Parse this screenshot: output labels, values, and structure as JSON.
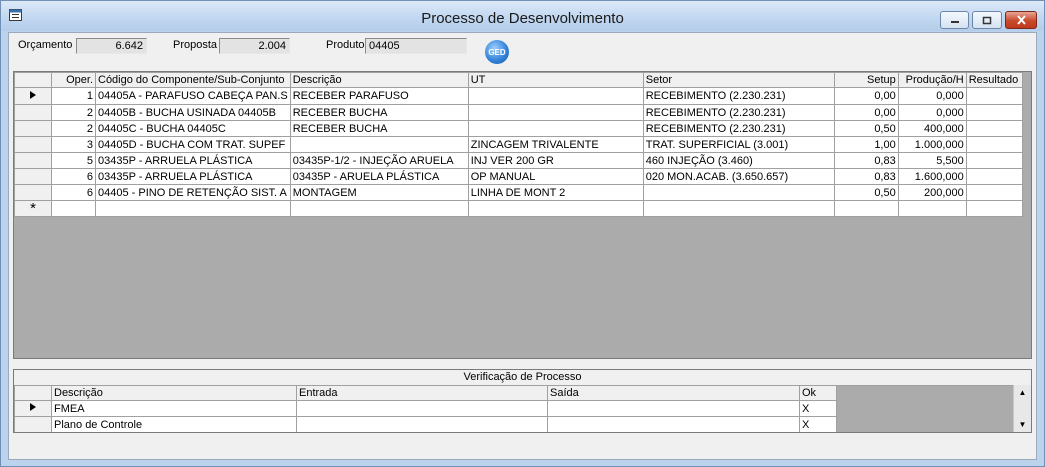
{
  "window": {
    "title": "Processo de Desenvolvimento"
  },
  "header": {
    "orcamento_label": "Orçamento",
    "orcamento_value": "6.642",
    "proposta_label": "Proposta",
    "proposta_value": "2.004",
    "produto_label": "Produto",
    "produto_value": "04405",
    "ged_label": "GED"
  },
  "grid": {
    "columns": [
      "Oper.",
      "Código do Componente/Sub-Conjunto",
      "Descrição",
      "UT",
      "Setor",
      "Setup",
      "Produção/H",
      "Resultado"
    ],
    "rows": [
      {
        "oper": "1",
        "codigo": "04405A  -  PARAFUSO CABEÇA PAN.S",
        "descricao": "RECEBER PARAFUSO",
        "ut": "",
        "setor": "RECEBIMENTO (2.230.231)",
        "setup": "0,00",
        "producao": "0,000",
        "resultado": ""
      },
      {
        "oper": "2",
        "codigo": "04405B  -  BUCHA USINADA 04405B",
        "descricao": "RECEBER BUCHA",
        "ut": "",
        "setor": "RECEBIMENTO (2.230.231)",
        "setup": "0,00",
        "producao": "0,000",
        "resultado": ""
      },
      {
        "oper": "2",
        "codigo": "04405C  -  BUCHA 04405C",
        "descricao": "RECEBER BUCHA",
        "ut": "",
        "setor": "RECEBIMENTO (2.230.231)",
        "setup": "0,50",
        "producao": "400,000",
        "resultado": ""
      },
      {
        "oper": "3",
        "codigo": "04405D  -  BUCHA COM TRAT. SUPEF",
        "descricao": "",
        "ut": "ZINCAGEM TRIVALENTE",
        "setor": "TRAT. SUPERFICIAL (3.001)",
        "setup": "1,00",
        "producao": "1.000,000",
        "resultado": ""
      },
      {
        "oper": "5",
        "codigo": "03435P  -  ARRUELA PLÁSTICA",
        "descricao": "03435P-1/2 - INJEÇÃO ARUELA",
        "ut": "INJ VER 200 GR",
        "setor": "460 INJEÇÃO (3.460)",
        "setup": "0,83",
        "producao": "5,500",
        "resultado": ""
      },
      {
        "oper": "6",
        "codigo": "03435P  -  ARRUELA PLÁSTICA",
        "descricao": "03435P - ARUELA PLÁSTICA",
        "ut": "OP MANUAL",
        "setor": "020 MON.ACAB. (3.650.657)",
        "setup": "0,83",
        "producao": "1.600,000",
        "resultado": ""
      },
      {
        "oper": "6",
        "codigo": "04405  -  PINO DE RETENÇÃO SIST. A",
        "descricao": "MONTAGEM",
        "ut": "LINHA DE MONT 2",
        "setor": "",
        "setup": "0,50",
        "producao": "200,000",
        "resultado": ""
      }
    ],
    "new_row_marker": "*"
  },
  "verificacao": {
    "title": "Verificação de Processo",
    "columns": [
      "Descrição",
      "Entrada",
      "Saída",
      "Ok"
    ],
    "rows": [
      {
        "descricao": "FMEA",
        "entrada": "",
        "saida": "",
        "ok": "X"
      },
      {
        "descricao": "Plano de Controle",
        "entrada": "",
        "saida": "",
        "ok": "X"
      }
    ]
  }
}
